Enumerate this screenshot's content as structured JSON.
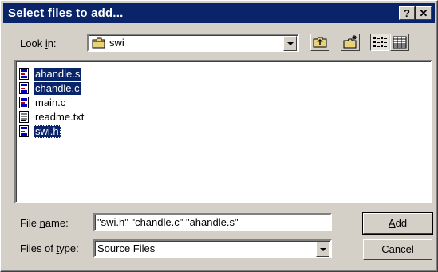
{
  "window": {
    "title": "Select files to add...",
    "help_btn": "?",
    "close_btn": "✕"
  },
  "look_in": {
    "label_pre": "Look ",
    "label_u": "i",
    "label_post": "n:",
    "value": "swi"
  },
  "files": [
    {
      "name": "ahandle.s",
      "icon": "source-file-icon",
      "selected": true
    },
    {
      "name": "chandle.c",
      "icon": "source-file-icon",
      "selected": true
    },
    {
      "name": "main.c",
      "icon": "source-file-icon",
      "selected": false
    },
    {
      "name": "readme.txt",
      "icon": "text-file-icon",
      "selected": false
    },
    {
      "name": "swi.h",
      "icon": "source-file-icon",
      "selected": true
    }
  ],
  "file_name": {
    "label_pre": "File ",
    "label_u": "n",
    "label_post": "ame:",
    "value": "\"swi.h\" \"chandle.c\" \"ahandle.s\""
  },
  "file_type": {
    "label_pre": "Files of ",
    "label_u": "t",
    "label_post": "ype:",
    "value": "Source Files"
  },
  "buttons": {
    "add_u": "A",
    "add_rest": "dd",
    "cancel": "Cancel"
  },
  "colors": {
    "title_bar": "#0a246a",
    "selection": "#0a246a",
    "face": "#d4d0c8"
  }
}
